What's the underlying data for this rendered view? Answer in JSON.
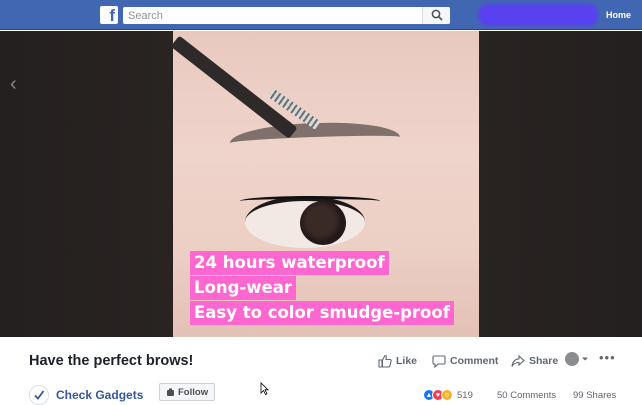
{
  "header": {
    "logo_letter": "f",
    "search_placeholder": "Search",
    "home_label": "Home",
    "brand_color": "#4267b2"
  },
  "video": {
    "caption_lines": [
      "24 hours waterproof",
      "Long-wear",
      "Easy to color smudge-proof"
    ],
    "caption_bg_color": "#ff67d0"
  },
  "post": {
    "title": "Have the perfect brows!",
    "actions": {
      "like": "Like",
      "comment": "Comment",
      "share": "Share"
    },
    "page": {
      "name": "Check Gadgets",
      "follow_label": "Follow"
    },
    "stats": {
      "reactions": "519",
      "comments": "50 Comments",
      "shares": "99 Shares"
    }
  },
  "icons": [
    "facebook-logo-icon",
    "search-icon",
    "back-arrow-icon",
    "like-icon",
    "comment-icon",
    "share-icon",
    "chevron-down-icon",
    "more-icon",
    "follow-icon",
    "cursor-icon"
  ]
}
